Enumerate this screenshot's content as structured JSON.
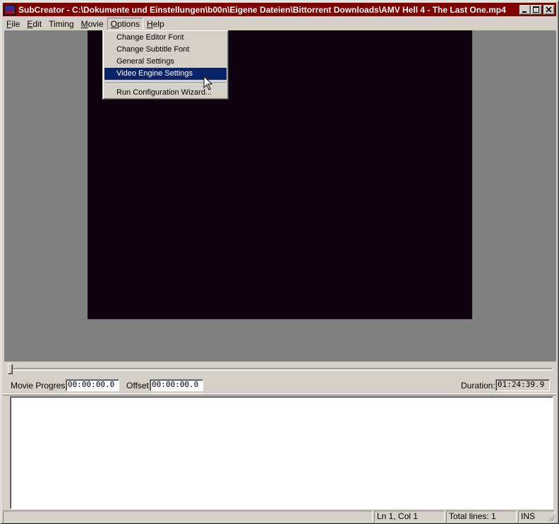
{
  "window": {
    "title": "SubCreator - C:\\Dokumente und Einstellungen\\b00n\\Eigene Dateien\\Bittorrent Downloads\\AMV Hell 4 - The Last One.mp4",
    "minimize": "_",
    "maximize": "□",
    "close": "×"
  },
  "menubar": {
    "items": [
      {
        "first": "F",
        "rest": "ile"
      },
      {
        "first": "E",
        "rest": "dit"
      },
      {
        "first": "",
        "rest": "Timing"
      },
      {
        "first": "M",
        "rest": "ovie"
      },
      {
        "first": "O",
        "rest": "ptions"
      },
      {
        "first": "H",
        "rest": "elp"
      }
    ],
    "active": "Options"
  },
  "options_menu": {
    "items": [
      "Change Editor Font",
      "Change Subtitle Font",
      "General Settings",
      "Video Engine Settings",
      "Run Configuration Wizard..."
    ],
    "highlighted": "Video Engine Settings"
  },
  "controls": {
    "movie_progress_label": "Movie Progress:",
    "movie_progress_value": "00:00:00.0",
    "offset_label": "Offset:",
    "offset_value": "00:00:00.0",
    "duration_label": "Duration:",
    "duration_value": "01:24:39.9"
  },
  "statusbar": {
    "position": "Ln 1, Col 1",
    "total_lines": "Total lines: 1",
    "mode": "INS"
  },
  "colors": {
    "titlebar": "#800000",
    "highlight": "#0a246a",
    "video_bg": "#0f0310",
    "workspace": "#808080"
  }
}
